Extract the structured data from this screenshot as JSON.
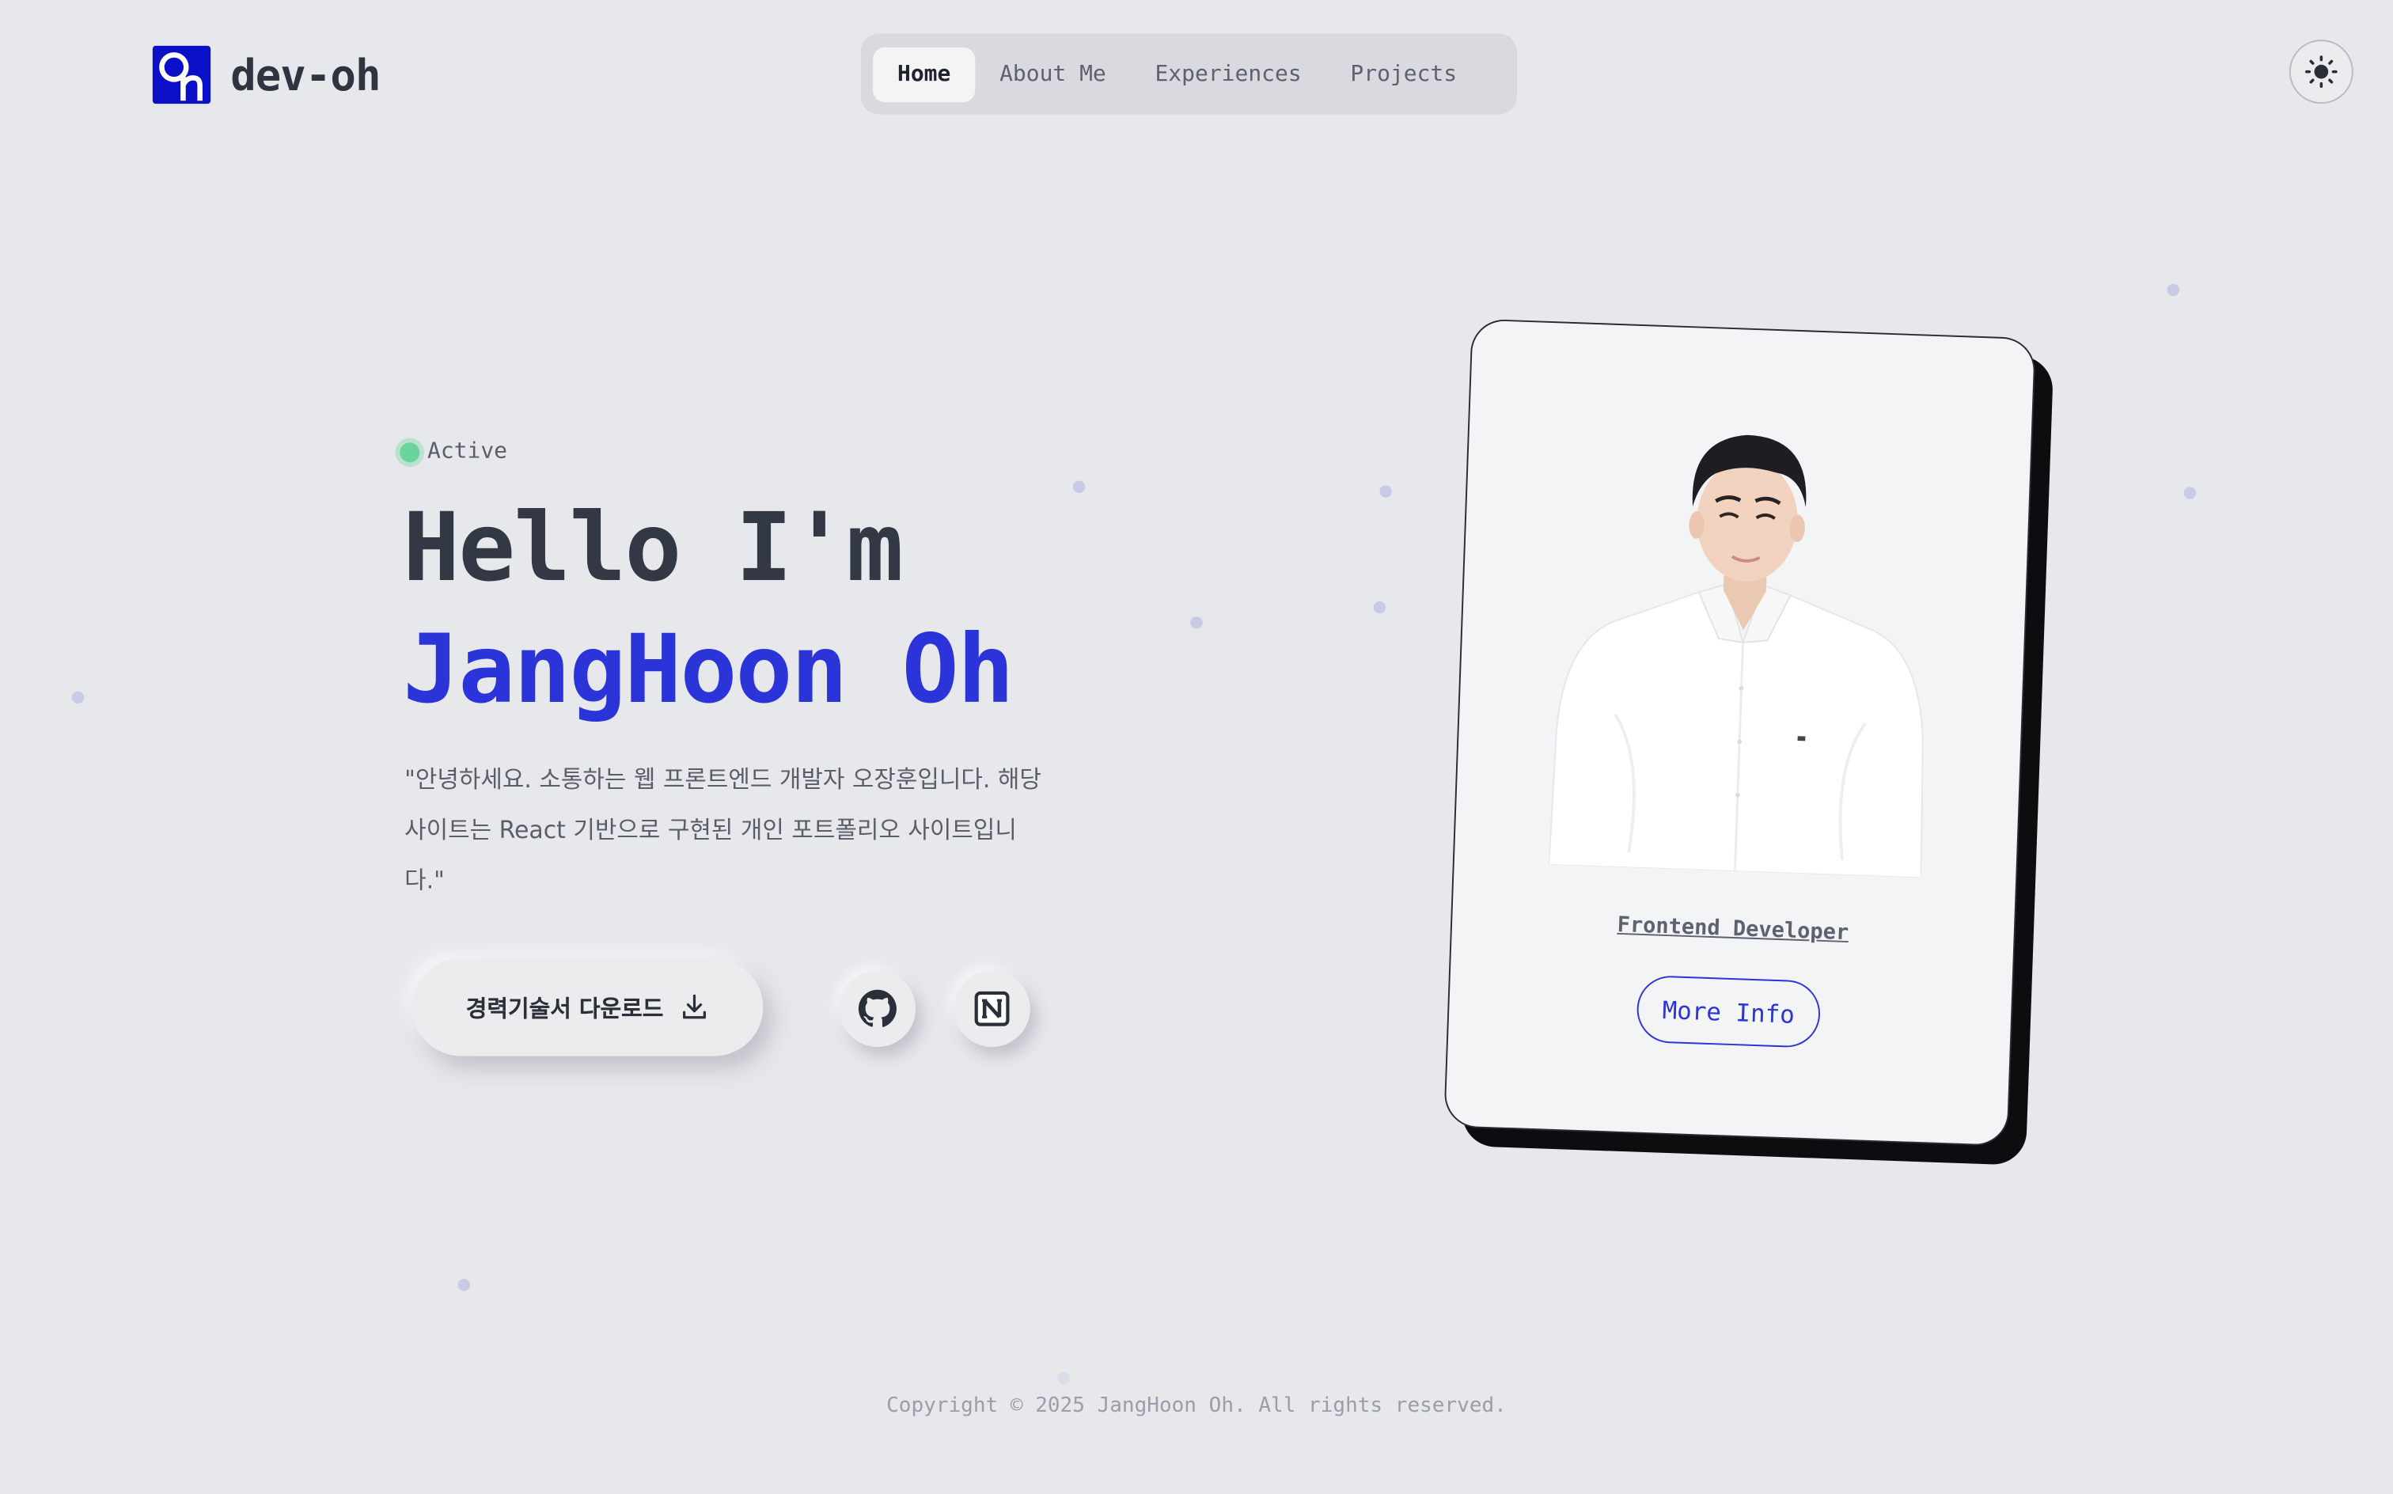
{
  "header": {
    "logo_text": "dev-oh",
    "nav": [
      {
        "label": "Home",
        "active": true
      },
      {
        "label": "About Me",
        "active": false
      },
      {
        "label": "Experiences",
        "active": false
      },
      {
        "label": "Projects",
        "active": false
      }
    ],
    "theme_toggle_icon": "sun-icon"
  },
  "hero": {
    "status": "Active",
    "line1": "Hello I'm",
    "line2": "JangHoon Oh",
    "description": "\"안녕하세요. 소통하는 웹 프론트엔드 개발자 오장훈입니다. 해당 사이트는 React 기반으로 구현된 개인 포트폴리오 사이트입니다.\"",
    "download_label": "경력기술서 다운로드",
    "download_icon": "download-icon",
    "social": [
      {
        "icon": "github-icon"
      },
      {
        "icon": "notion-icon"
      }
    ]
  },
  "card": {
    "role": "Frontend Developer",
    "more_info_label": "More Info"
  },
  "footer": {
    "copyright": "Copyright © 2025 JangHoon Oh. All rights reserved."
  },
  "colors": {
    "accent": "#2b34d8",
    "logo_bg": "#0b10c8",
    "background": "#e7e8ec",
    "status": "#6ad49a"
  }
}
